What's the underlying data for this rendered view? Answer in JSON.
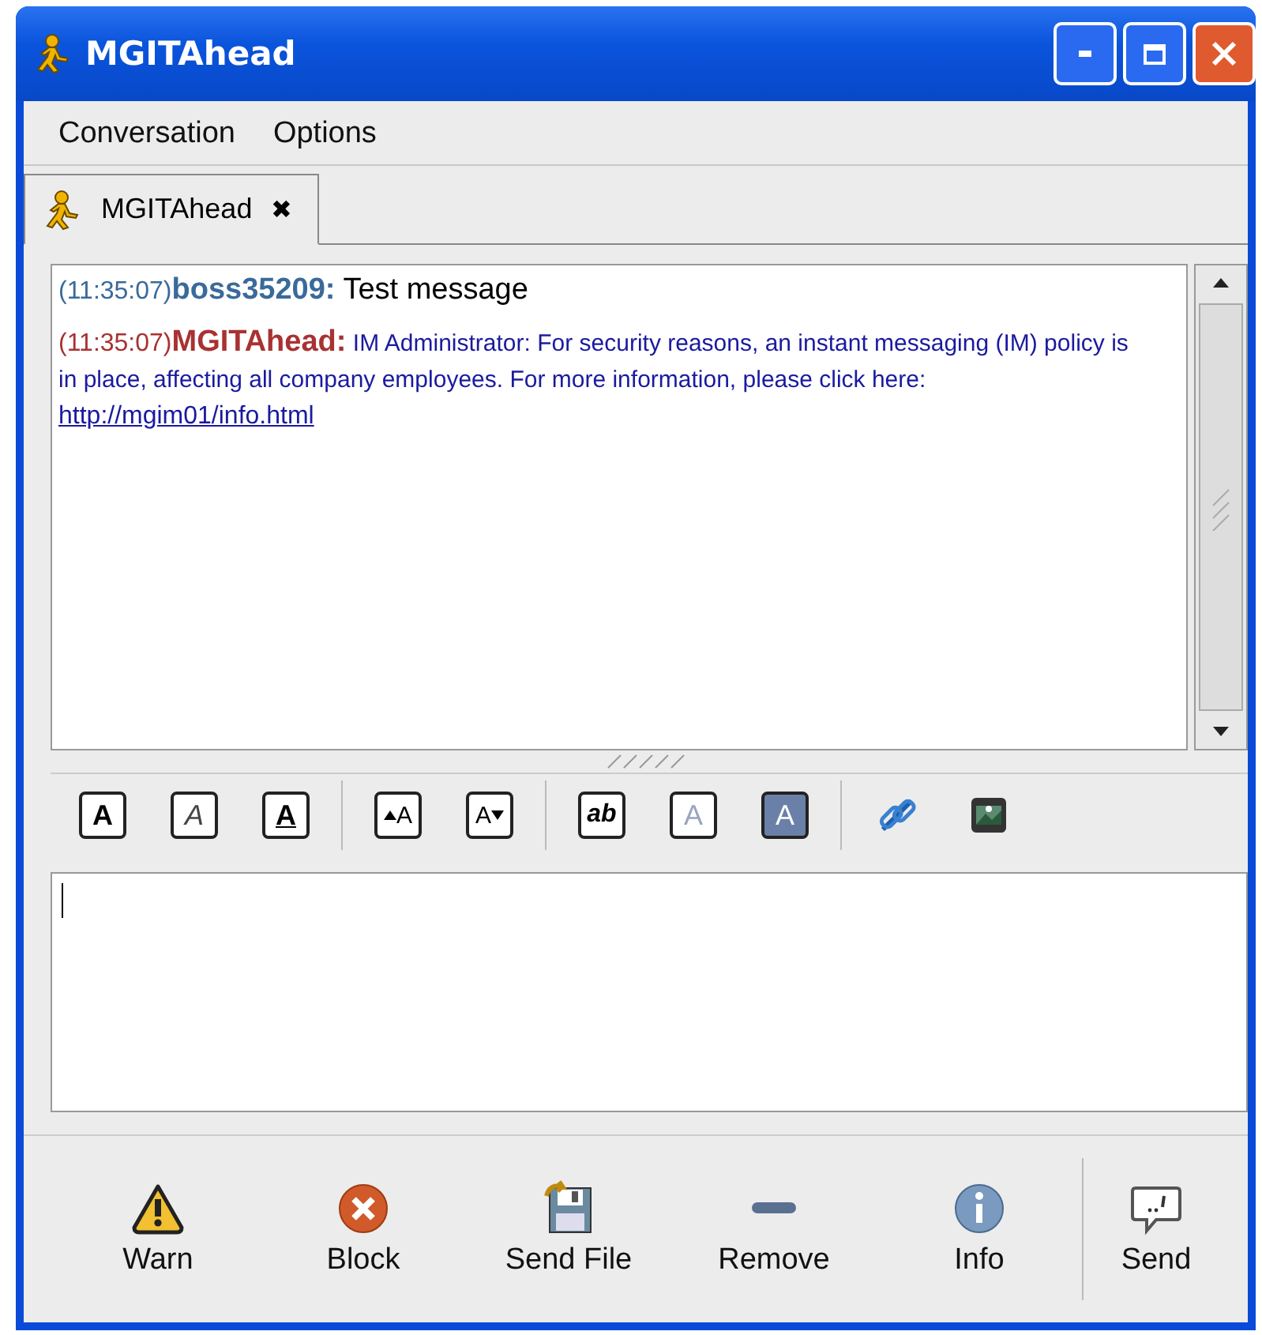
{
  "window": {
    "title": "MGITAhead"
  },
  "menu": [
    {
      "label": "Conversation"
    },
    {
      "label": "Options"
    }
  ],
  "tabs": [
    {
      "label": "MGITAhead",
      "close": "✖",
      "selected": true
    }
  ],
  "messages": [
    {
      "kind": "user",
      "time": "(11:35:07)",
      "sender": "boss35209:",
      "color": "#3a6a9a",
      "text": "Test message"
    },
    {
      "kind": "system",
      "time": "(11:35:07)",
      "sender": "MGITAhead:",
      "color": "#a83232",
      "text": "IM Administrator: For security reasons, an instant messaging (IM) policy is in place, affecting all company employees. For more information, please click here: ",
      "link": "http://mgim01/info.html"
    }
  ],
  "format_toolbar": [
    {
      "kind": "bold",
      "glyph": "A"
    },
    {
      "kind": "italic",
      "glyph": "A"
    },
    {
      "kind": "underline",
      "glyph": "A"
    },
    {
      "kind": "sep"
    },
    {
      "kind": "larger",
      "glyph": "A"
    },
    {
      "kind": "smaller",
      "glyph": "A"
    },
    {
      "kind": "sep"
    },
    {
      "kind": "font",
      "glyph": "ab"
    },
    {
      "kind": "fgcolor",
      "glyph": "A"
    },
    {
      "kind": "bgcolor",
      "glyph": "A"
    },
    {
      "kind": "sep"
    },
    {
      "kind": "link"
    },
    {
      "kind": "image"
    }
  ],
  "actions": [
    {
      "kind": "warn",
      "label": "Warn"
    },
    {
      "kind": "block",
      "label": "Block"
    },
    {
      "kind": "sendfile",
      "label": "Send File"
    },
    {
      "kind": "remove",
      "label": "Remove"
    },
    {
      "kind": "info",
      "label": "Info"
    },
    {
      "kind": "sep"
    },
    {
      "kind": "send",
      "label": "Send"
    }
  ]
}
